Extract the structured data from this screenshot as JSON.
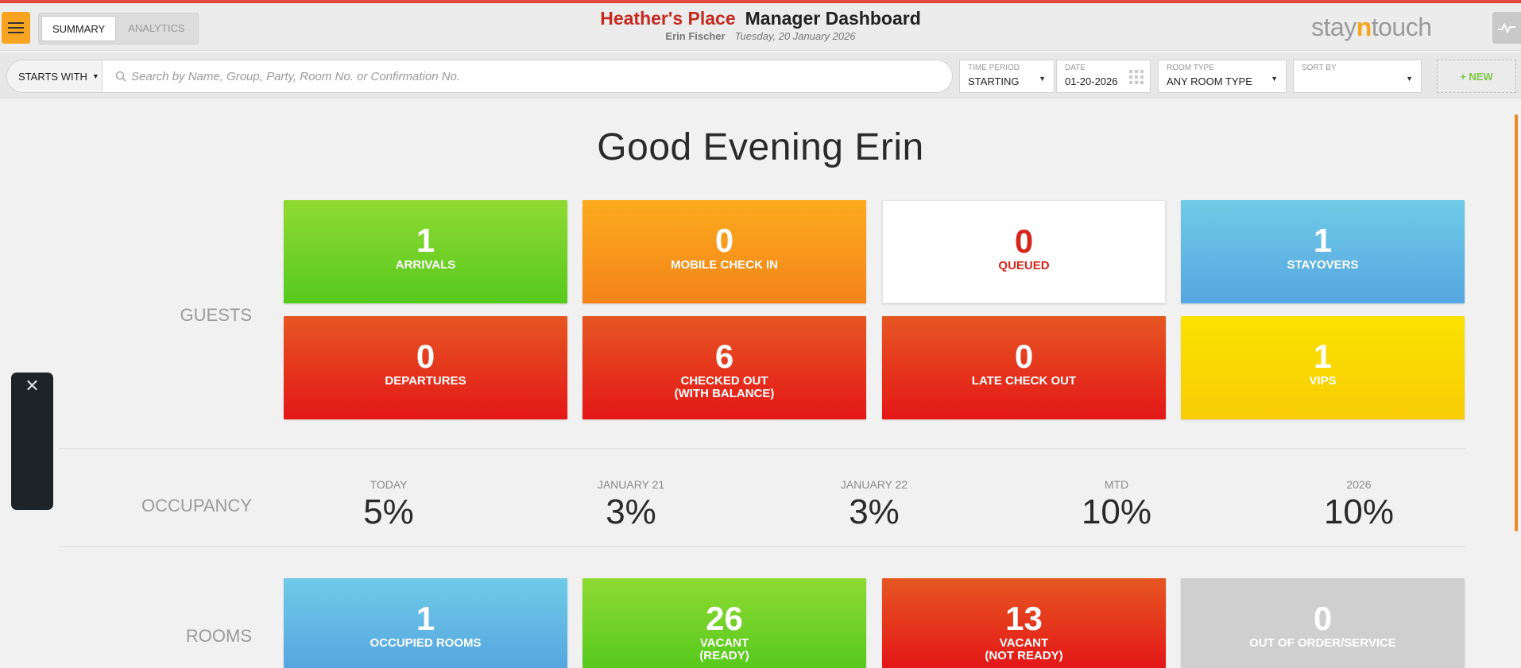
{
  "header": {
    "hotel_name": "Heather's Place",
    "dashboard_title": "Manager Dashboard",
    "user_name": "Erin Fischer",
    "current_date": "Tuesday, 20 January 2026",
    "logo_prefix": "stay",
    "logo_n": "n",
    "logo_suffix": "touch",
    "tabs": [
      {
        "label": "SUMMARY",
        "active": true
      },
      {
        "label": "ANALYTICS",
        "active": false
      }
    ]
  },
  "search": {
    "starts_with_label": "STARTS WITH",
    "placeholder": "Search by Name, Group, Party, Room No. or Confirmation No.",
    "time_period": {
      "label": "TIME PERIOD",
      "value": "STARTING"
    },
    "date": {
      "label": "DATE",
      "value": "01-20-2026"
    },
    "room_type": {
      "label": "ROOM TYPE",
      "value": "ANY ROOM TYPE"
    },
    "sort_by": {
      "label": "SORT BY",
      "value": ""
    },
    "new_button": "+ NEW"
  },
  "greeting": "Good Evening Erin",
  "guests": {
    "section_label": "GUESTS",
    "tiles": [
      {
        "value": "1",
        "label": "ARRIVALS",
        "color": "#6bd024"
      },
      {
        "value": "0",
        "label": "MOBILE CHECK IN",
        "color": "#f7951b"
      },
      {
        "value": "0",
        "label": "QUEUED",
        "color": "#ffffff"
      },
      {
        "value": "1",
        "label": "STAYOVERS",
        "color": "#5fb6e3"
      },
      {
        "value": "0",
        "label": "DEPARTURES",
        "color": "#e4331c"
      },
      {
        "value": "6",
        "label_line1": "CHECKED OUT",
        "label_line2": "(WITH BALANCE)",
        "color": "#e4331c"
      },
      {
        "value": "0",
        "label": "LATE CHECK OUT",
        "color": "#e4331c"
      },
      {
        "value": "1",
        "label": "VIPS",
        "color": "#f9d703"
      }
    ]
  },
  "occupancy": {
    "section_label": "OCCUPANCY",
    "items": [
      {
        "heading": "TODAY",
        "value": "5%"
      },
      {
        "heading": "JANUARY 21",
        "value": "3%"
      },
      {
        "heading": "JANUARY 22",
        "value": "3%"
      },
      {
        "heading": "MTD",
        "value": "10%"
      },
      {
        "heading": "2026",
        "value": "10%"
      }
    ]
  },
  "rooms": {
    "section_label": "ROOMS",
    "tiles": [
      {
        "value": "1",
        "label": "OCCUPIED ROOMS",
        "color": "#5fb6e3"
      },
      {
        "value": "26",
        "label_line1": "VACANT",
        "label_line2": "(READY)",
        "color": "#6bd024"
      },
      {
        "value": "13",
        "label_line1": "VACANT",
        "label_line2": "(NOT READY)",
        "color": "#e4331c"
      },
      {
        "value": "0",
        "label": "OUT OF ORDER/SERVICE",
        "color": "#cfcfcf"
      }
    ]
  },
  "floating_panel": {
    "close_icon": "close-icon"
  }
}
